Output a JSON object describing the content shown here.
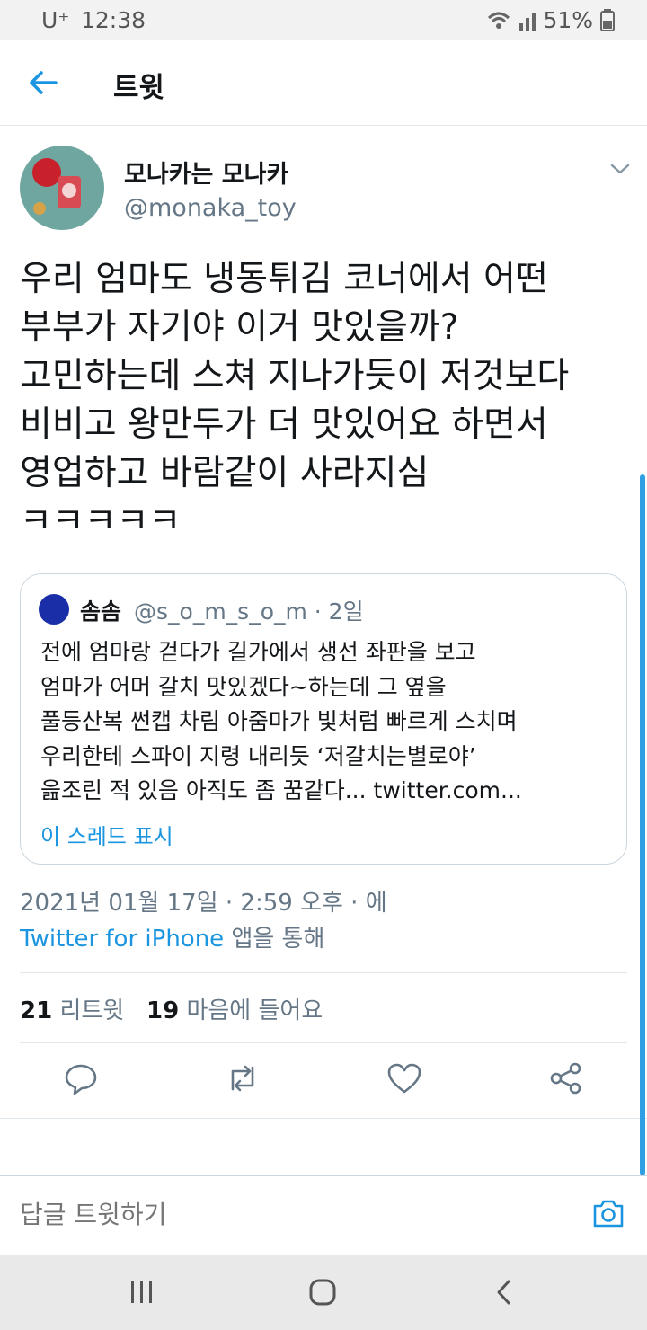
{
  "status_bar": {
    "carrier": "U⁺",
    "time": "12:38",
    "battery": "51%"
  },
  "header": {
    "title": "트윗"
  },
  "tweet": {
    "author_name": "모나카는 모나카",
    "author_handle": "@monaka_toy",
    "text": "우리 엄마도 냉동튀김 코너에서 어떤\n부부가 자기야 이거 맛있을까?\n고민하는데 스쳐 지나가듯이 저것보다\n비비고 왕만두가 더 맛있어요 하면서\n영업하고 바람같이 사라지심\nㅋㅋㅋㅋㅋ",
    "quote": {
      "name": "솜솜",
      "handle_time": "@s_o_m_s_o_m · 2일",
      "text": "전에 엄마랑 걷다가 길가에서 생선 좌판을 보고\n엄마가 어머 갈치 맛있겠다~하는데 그 옆을\n풀등산복 썬캡 차림 아줌마가 빛처럼 빠르게 스치며\n우리한테 스파이 지령 내리듯 ‘저갈치는별로야’\n읊조린 적 있음 아직도 좀 꿈같다... twitter.com...",
      "show_thread": "이 스레드 표시"
    },
    "timestamp": "2021년 01월 17일 · 2:59 오후 · 에",
    "source_link": "Twitter for iPhone",
    "source_suffix": " 앱을 통해",
    "retweet_count": "21",
    "retweet_label": " 리트윗",
    "like_count": "19",
    "like_label": " 마음에 들어요"
  },
  "reply": {
    "placeholder": "답글 트윗하기"
  },
  "colors": {
    "accent": "#1b95e0",
    "secondary_text": "#657786",
    "border": "#e1e8ed"
  }
}
